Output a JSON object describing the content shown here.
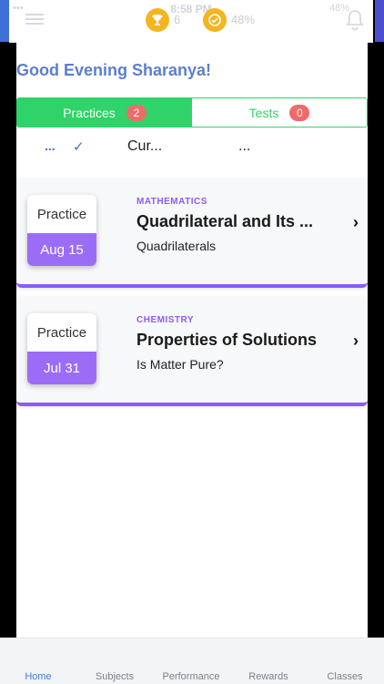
{
  "status": {
    "time": "8:58 PM",
    "left": "•••",
    "battery": "48%"
  },
  "header": {
    "trophy_count": "6",
    "check_value": "48%"
  },
  "greeting": "Good Evening Sharanya!",
  "tabs": [
    {
      "label": "Practices",
      "badge": "2",
      "active": true
    },
    {
      "label": "Tests",
      "badge": "0",
      "active": false
    }
  ],
  "filters": {
    "dots": "...",
    "check": "✓",
    "current": "Cur...",
    "more": "..."
  },
  "cards": [
    {
      "type": "Practice",
      "date": "Aug 15",
      "subject": "MATHEMATICS",
      "title": "Quadrilateral and Its ...",
      "topic": "Quadrilaterals"
    },
    {
      "type": "Practice",
      "date": "Jul 31",
      "subject": "CHEMISTRY",
      "title": "Properties of Solutions",
      "topic": "Is Matter Pure?"
    }
  ],
  "nav": [
    {
      "label": "Home"
    },
    {
      "label": "Subjects"
    },
    {
      "label": "Performance"
    },
    {
      "label": "Rewards"
    },
    {
      "label": "Classes"
    }
  ],
  "colors": {
    "accent_green": "#2fd36a",
    "accent_purple": "#8a5cf6",
    "greeting_blue": "#5b7fcf",
    "coin_gold": "#f4b521",
    "badge_red": "#f06a6a"
  },
  "icons": [
    "hamburger-icon",
    "trophy-icon",
    "check-badge-icon",
    "bell-icon",
    "chevron-right-icon"
  ]
}
